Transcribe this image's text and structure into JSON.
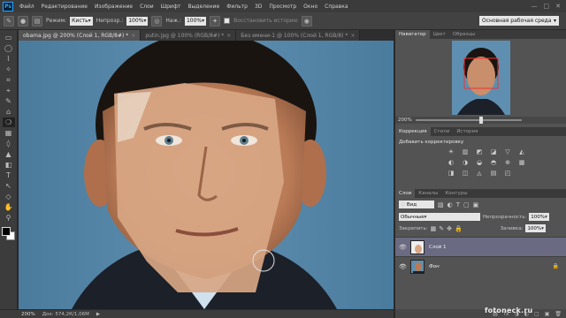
{
  "app": {
    "logo": "Ps"
  },
  "menu": [
    "Файл",
    "Редактирование",
    "Изображение",
    "Слои",
    "Шрифт",
    "Выделение",
    "Фильтр",
    "3D",
    "Просмотр",
    "Окно",
    "Справка"
  ],
  "window_controls": [
    "—",
    "□",
    "✕"
  ],
  "options_bar": {
    "mode_label": "Режим:",
    "mode_value": "Кисть",
    "opacity_label": "Непрозр.:",
    "opacity_value": "100%",
    "pressure_label": "Наж.:",
    "pressure_value": "100%",
    "history_label": "Восстановить историю",
    "workspace": "Основная рабочая среда"
  },
  "doc_tabs": [
    {
      "label": "obama.jpg @ 200% (Слой 1, RGB/8#) *",
      "active": true
    },
    {
      "label": "putin.jpg @ 100% (RGB/8#) *",
      "active": false
    },
    {
      "label": "Без имени-1 @ 100% (Слой 1, RGB/8) *",
      "active": false
    }
  ],
  "tools": [
    "▭",
    "◯",
    "⌇",
    "✧",
    "⌗",
    "⌖",
    "✎",
    "⌂",
    "❍",
    "▦",
    "◊",
    "▲",
    "◧",
    "T",
    "↖",
    "◇",
    "✋",
    "⚲"
  ],
  "status": {
    "zoom": "200%",
    "doc": "Док: 574,2К/1,06М",
    "arrow": "▶"
  },
  "navigator": {
    "tabs": [
      "Навигатор",
      "Цвет",
      "Образцы"
    ],
    "zoom": "200%"
  },
  "adjustments": {
    "tabs": [
      "Коррекция",
      "Стили",
      "История"
    ],
    "title": "Добавить корректировку",
    "row1": [
      "☀",
      "▥",
      "◩",
      "◪",
      "▽",
      "◭"
    ],
    "row2": [
      "◐",
      "◑",
      "◒",
      "◓",
      "⊕",
      "▦"
    ],
    "row3": [
      "◨",
      "◫",
      "◬",
      "▤",
      "◰"
    ]
  },
  "layers": {
    "tabs": [
      "Слои",
      "Каналы",
      "Контуры"
    ],
    "kind_label": "Вид",
    "blend_mode": "Обычные",
    "opacity_label": "Непрозрачность:",
    "opacity_value": "100%",
    "lock_label": "Закрепить:",
    "fill_label": "Заливка:",
    "fill_value": "100%",
    "items": [
      {
        "name": "Слой 1",
        "active": true
      },
      {
        "name": "Фон",
        "active": false
      }
    ],
    "footer_icons": [
      "⛓",
      "fx",
      "◑",
      "◐",
      "▢",
      "▣",
      "🗑"
    ]
  },
  "watermark": "fotoneck.ru",
  "colors": {
    "canvas_bg": "#4f7fa0",
    "skin": "#c98e6b",
    "paste_skin": "#dcab8a",
    "suit": "#1c2029"
  }
}
